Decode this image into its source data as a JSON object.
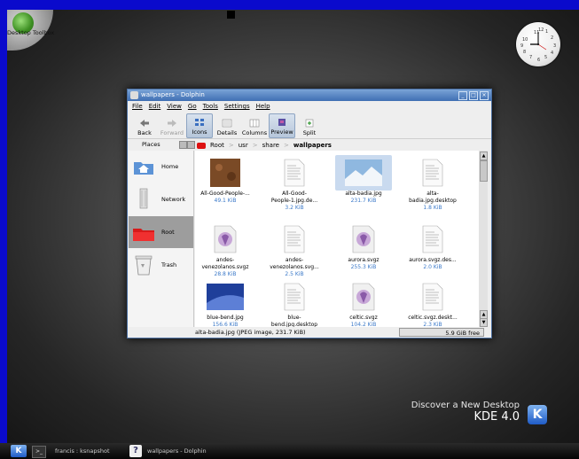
{
  "desktop": {
    "toolbox_label": "Desktop Toolbox",
    "clock_numbers": [
      "11",
      "12",
      "1",
      "2",
      "10",
      "9",
      "3",
      "8",
      "7",
      "6",
      "5",
      "4"
    ],
    "kde_discover": "Discover a New Desktop",
    "kde_version": "KDE 4.0",
    "kde_logo": "K"
  },
  "window": {
    "title": "wallpapers - Dolphin",
    "controls": [
      "_",
      "□",
      "×"
    ],
    "menu": [
      "File",
      "Edit",
      "View",
      "Go",
      "Tools",
      "Settings",
      "Help"
    ],
    "toolbar": [
      {
        "label": "Back",
        "icon": "back-arrow-icon",
        "active": false,
        "disabled": false
      },
      {
        "label": "Forward",
        "icon": "forward-arrow-icon",
        "active": false,
        "disabled": true
      },
      {
        "label": "Icons",
        "icon": "icons-view-icon",
        "active": true,
        "disabled": false
      },
      {
        "label": "Details",
        "icon": "details-view-icon",
        "active": false,
        "disabled": false
      },
      {
        "label": "Columns",
        "icon": "columns-view-icon",
        "active": false,
        "disabled": false
      },
      {
        "label": "Preview",
        "icon": "preview-icon",
        "active": true,
        "disabled": false
      },
      {
        "label": "Split",
        "icon": "split-icon",
        "active": false,
        "disabled": false
      }
    ],
    "places_title": "Places",
    "places": [
      {
        "label": "Home",
        "icon": "home-folder-icon",
        "selected": false
      },
      {
        "label": "Network",
        "icon": "network-icon",
        "selected": false
      },
      {
        "label": "Root",
        "icon": "root-folder-icon",
        "selected": true
      },
      {
        "label": "Trash",
        "icon": "trash-icon",
        "selected": false
      }
    ],
    "breadcrumb": [
      "Root",
      "usr",
      "share",
      "wallpapers"
    ],
    "breadcrumb_sep": ">",
    "files": [
      {
        "name1": "All-Good-People-...",
        "name2": "",
        "size": "49.1 KiB",
        "kind": "photo-brown",
        "selected": false
      },
      {
        "name1": "All-Good-",
        "name2": "People-1.jpg.de...",
        "size": "3.2 KiB",
        "kind": "document",
        "selected": false
      },
      {
        "name1": "alta-badia.jpg",
        "name2": "",
        "size": "231.7 KiB",
        "kind": "photo-snow",
        "selected": true
      },
      {
        "name1": "alta-",
        "name2": "badia.jpg.desktop",
        "size": "1.8 KiB",
        "kind": "document",
        "selected": false
      },
      {
        "name1": "andes-",
        "name2": "venezolanos.svgz",
        "size": "28.8 KiB",
        "kind": "svg",
        "selected": false
      },
      {
        "name1": "andes-",
        "name2": "venezolanos.svg...",
        "size": "2.5 KiB",
        "kind": "document",
        "selected": false
      },
      {
        "name1": "aurora.svgz",
        "name2": "",
        "size": "255.3 KiB",
        "kind": "svg",
        "selected": false
      },
      {
        "name1": "aurora.svgz.des...",
        "name2": "",
        "size": "2.0 KiB",
        "kind": "document",
        "selected": false
      },
      {
        "name1": "blue-bend.jpg",
        "name2": "",
        "size": "156.6 KiB",
        "kind": "photo-blue",
        "selected": false
      },
      {
        "name1": "blue-",
        "name2": "bend.jpg.desktop",
        "size": "2.4 KiB",
        "kind": "document",
        "selected": false
      },
      {
        "name1": "celtic.svgz",
        "name2": "",
        "size": "104.2 KiB",
        "kind": "svg",
        "selected": false
      },
      {
        "name1": "celtic.svgz.deskt...",
        "name2": "",
        "size": "2.3 KiB",
        "kind": "document",
        "selected": false
      }
    ],
    "status_text": "alta-badia.jpg (JPEG image, 231.7 KiB)",
    "free_space": "5.9 GiB free"
  },
  "taskbar": {
    "kde_button": "K",
    "terminal_glyph": ">_",
    "task1": "francis : ksnapshot",
    "help_glyph": "?",
    "task2": "wallpapers - Dolphin"
  },
  "colors": {
    "border_blue": "#0a0acc",
    "title_blue": "#3f6fb3",
    "link_blue": "#3a78c8",
    "selection": "#c9daef"
  }
}
